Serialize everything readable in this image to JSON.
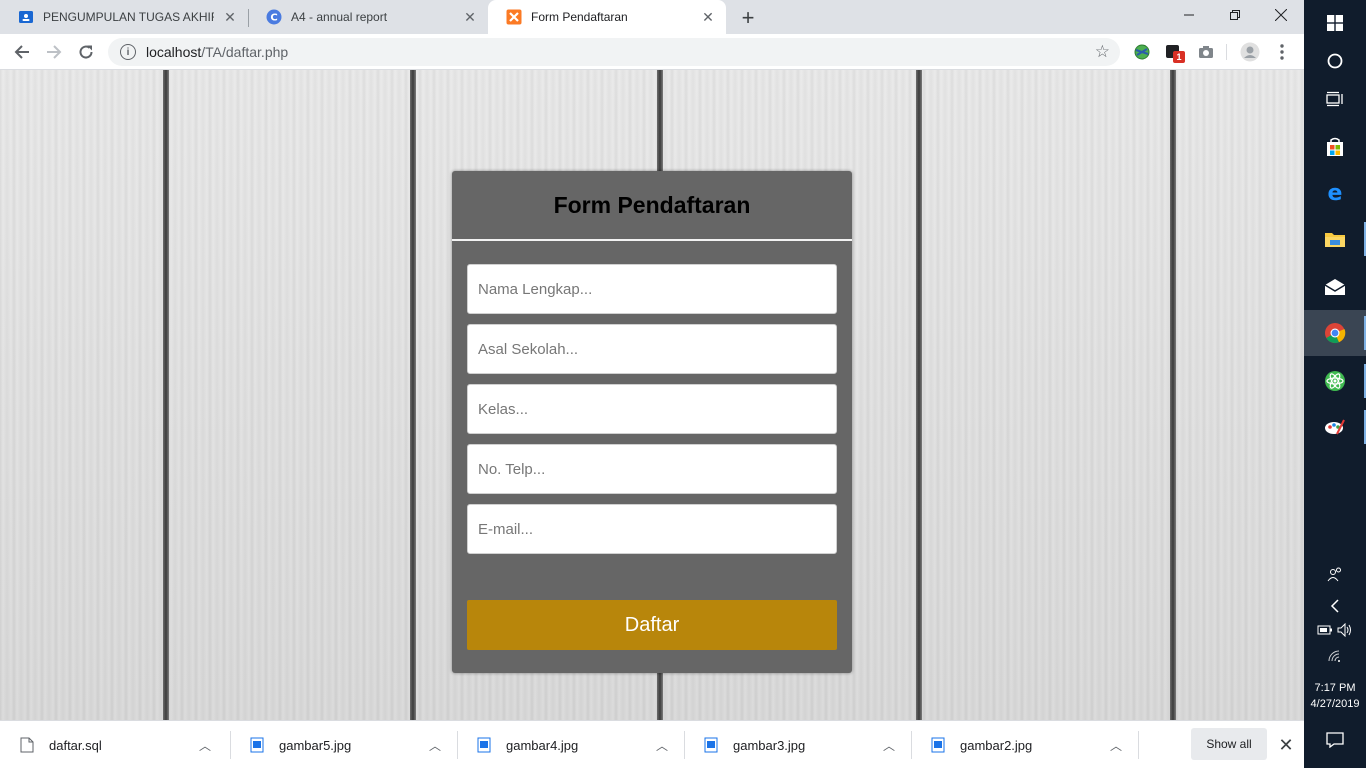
{
  "browser": {
    "tabs": [
      {
        "title": "PENGUMPULAN TUGAS AKHIR W",
        "icon": "google-classroom-icon",
        "active": false
      },
      {
        "title": "A4 - annual report",
        "icon": "canva-icon",
        "active": false
      },
      {
        "title": "Form Pendaftaran",
        "icon": "xampp-icon",
        "active": true
      }
    ],
    "address": {
      "host": "localhost",
      "path": "/TA/daftar.php"
    },
    "extension_badge": "1"
  },
  "page": {
    "form": {
      "title": "Form Pendaftaran",
      "fields": [
        {
          "placeholder": "Nama Lengkap...",
          "value": ""
        },
        {
          "placeholder": "Asal Sekolah...",
          "value": ""
        },
        {
          "placeholder": "Kelas...",
          "value": ""
        },
        {
          "placeholder": "No. Telp...",
          "value": ""
        },
        {
          "placeholder": "E-mail...",
          "value": ""
        }
      ],
      "submit_label": "Daftar",
      "accent_color": "#b8860b",
      "card_color": "#666666"
    }
  },
  "downloads": {
    "items": [
      {
        "name": "daftar.sql",
        "icon": "file-icon"
      },
      {
        "name": "gambar5.jpg",
        "icon": "image-file-icon"
      },
      {
        "name": "gambar4.jpg",
        "icon": "image-file-icon"
      },
      {
        "name": "gambar3.jpg",
        "icon": "image-file-icon"
      },
      {
        "name": "gambar2.jpg",
        "icon": "image-file-icon"
      }
    ],
    "show_all_label": "Show all"
  },
  "taskbar": {
    "time": "7:17 PM",
    "date": "4/27/2019"
  }
}
